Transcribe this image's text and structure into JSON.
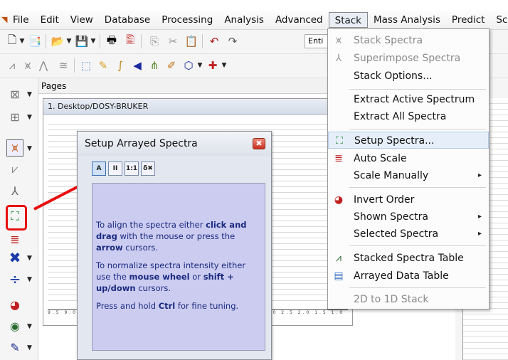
{
  "menubar": {
    "items": [
      {
        "label": "File"
      },
      {
        "label": "Edit"
      },
      {
        "label": "View"
      },
      {
        "label": "Database"
      },
      {
        "label": "Processing"
      },
      {
        "label": "Analysis"
      },
      {
        "label": "Advanced"
      },
      {
        "label": "Stack"
      },
      {
        "label": "Mass Analysis"
      },
      {
        "label": "Predict"
      },
      {
        "label": "Scrip"
      }
    ],
    "active": "Stack"
  },
  "toolbar": {
    "combo_value": "Enti"
  },
  "pages": {
    "header": "Pages",
    "document_title": "1. Desktop/DOSY-BRUKER",
    "axis_ticks": "9.5 9.0 8.5 8.0 7.5 7.0 6.5 6.0 5.5 5.0 4.5 4.0 3.5 3.0 2.5 2.0 1.5 1.0 0.5 0.0 -0.5 -1.0"
  },
  "dialog": {
    "title": "Setup Arrayed Spectra",
    "close_glyph": "✖",
    "buttons": [
      {
        "label": "A"
      },
      {
        "label": "II"
      },
      {
        "label": "1:1"
      },
      {
        "label": "δ✖"
      }
    ],
    "paragraph1": {
      "pre": "To align the spectra either ",
      "b1": "click and drag",
      "mid": " with the mouse or press the ",
      "b2": "arrow",
      "post": " cursors."
    },
    "paragraph2": {
      "pre": "To normalize spectra intensity either use the ",
      "b1": "mouse wheel",
      "mid": " or ",
      "b2": "shift + up/down",
      "post": " cursors."
    },
    "paragraph3": {
      "pre": "Press and hold ",
      "b1": "Ctrl",
      "post": " for fine tuning."
    }
  },
  "stack_menu": {
    "items": [
      {
        "label": "Stack Spectra",
        "disabled": true
      },
      {
        "label": "Superimpose Spectra",
        "disabled": true
      },
      {
        "label": "Stack Options..."
      },
      {
        "label": "Extract Active Spectrum"
      },
      {
        "label": "Extract All Spectra"
      },
      {
        "label": "Setup Spectra..."
      },
      {
        "label": "Auto Scale"
      },
      {
        "label": "Scale Manually",
        "submenu": true
      },
      {
        "label": "Invert Order"
      },
      {
        "label": "Shown Spectra",
        "submenu": true
      },
      {
        "label": "Selected Spectra",
        "submenu": true
      },
      {
        "label": "Stacked Spectra Table"
      },
      {
        "label": "Arrayed Data Table"
      },
      {
        "label": "2D to 1D Stack",
        "disabled": true
      }
    ],
    "hovered": "Setup Spectra...",
    "submenu_glyph": "▸"
  },
  "colors": {
    "highlight": "#e81010",
    "arrow": "#e81010",
    "dialog_body": "#ccccf0",
    "dialog_text": "#1a2a80"
  }
}
